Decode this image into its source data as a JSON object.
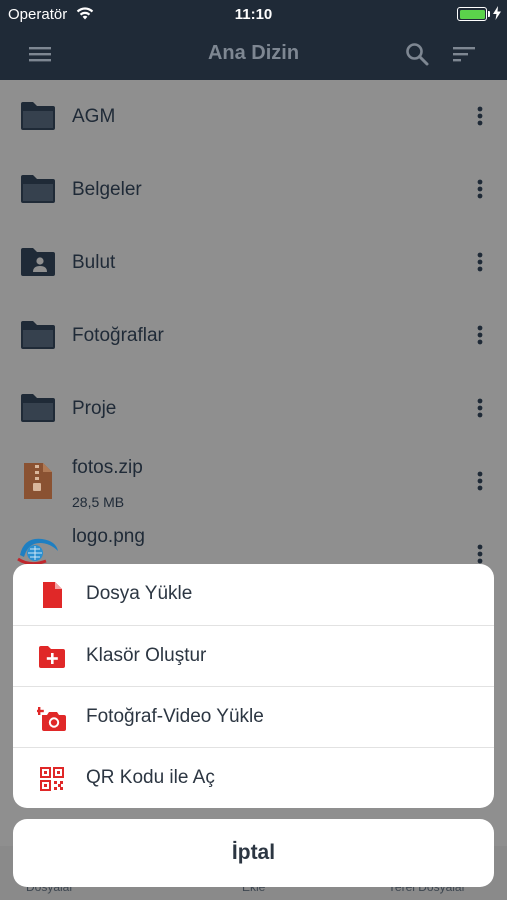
{
  "status_bar": {
    "carrier": "Operatör",
    "time": "11:10",
    "battery_level": 1.0
  },
  "nav": {
    "title": "Ana Dizin",
    "icons": [
      "menu-icon",
      "search-icon",
      "sort-icon"
    ]
  },
  "files": [
    {
      "name": "AGM",
      "type": "folder",
      "icon": "folder-icon"
    },
    {
      "name": "Belgeler",
      "type": "folder",
      "icon": "folder-icon"
    },
    {
      "name": "Bulut",
      "type": "shared-folder",
      "icon": "shared-folder-icon"
    },
    {
      "name": "Fotoğraflar",
      "type": "folder",
      "icon": "folder-icon"
    },
    {
      "name": "Proje",
      "type": "folder",
      "icon": "folder-icon"
    },
    {
      "name": "fotos.zip",
      "type": "zip",
      "size": "28,5 MB",
      "icon": "zip-file-icon"
    },
    {
      "name": "logo.png",
      "type": "image",
      "icon": "image-thumbnail"
    }
  ],
  "tab_bar": {
    "tabs": [
      "Dosyalar",
      "Ekle",
      "Yerel Dosyalar"
    ]
  },
  "action_sheet": {
    "items": [
      {
        "label": "Dosya Yükle",
        "icon": "file-upload-icon"
      },
      {
        "label": "Klasör Oluştur",
        "icon": "folder-add-icon"
      },
      {
        "label": "Fotoğraf-Video Yükle",
        "icon": "camera-add-icon"
      },
      {
        "label": "QR Kodu ile Aç",
        "icon": "qr-code-icon"
      }
    ],
    "cancel_label": "İptal"
  },
  "colors": {
    "header_bg": "#1f2a37",
    "accent_red": "#e02828",
    "overlay": "#8f8f8f"
  }
}
